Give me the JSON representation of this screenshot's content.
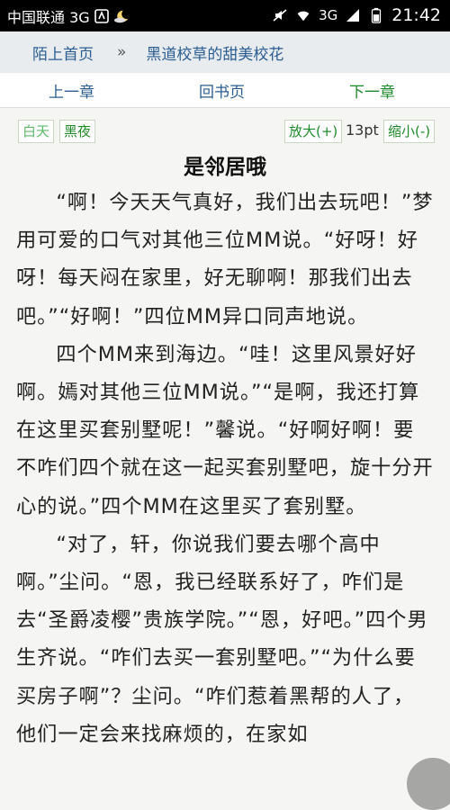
{
  "status_bar": {
    "carrier": "中国联通 3G",
    "network": "3G",
    "time": "21:42"
  },
  "breadcrumb": {
    "home": "陌上首页",
    "separator": "»",
    "book": "黑道校草的甜美校花"
  },
  "chapter_nav": {
    "prev": "上一章",
    "toc": "回书页",
    "next": "下一章"
  },
  "controls": {
    "day": "白天",
    "night": "黑夜",
    "zoom_in": "放大(+)",
    "font_size": "13pt",
    "zoom_out": "缩小(-)"
  },
  "chapter": {
    "title": "是邻居哦",
    "paragraphs": [
      "“啊！今天天气真好，我们出去玩吧！”梦用可爱的口气对其他三位MM说。“好呀！好呀！每天闷在家里，好无聊啊！那我们出去吧。”“好啊！”四位MM异口同声地说。",
      "四个MM来到海边。“哇！这里风景好好啊。嫣对其他三位MM说。”“是啊，我还打算在这里买套别墅呢！”馨说。“好啊好啊！要不咋们四个就在这一起买套别墅吧，旋十分开心的说。”四个MM在这里买了套别墅。",
      "“对了，轩，你说我们要去哪个高中啊。”尘问。“恩，我已经联系好了，咋们是去“圣爵凌樱”贵族学院。”“恩，好吧。”四个男生齐说。“咋们去买一套别墅吧。”“为什么要买房子啊”？尘问。“咋们惹着黑帮的人了，他们一定会来找麻烦的，在家如"
    ]
  },
  "colors": {
    "link_blue": "#2a5d91",
    "link_green": "#1f8a2a",
    "statusbar": "#000000"
  }
}
